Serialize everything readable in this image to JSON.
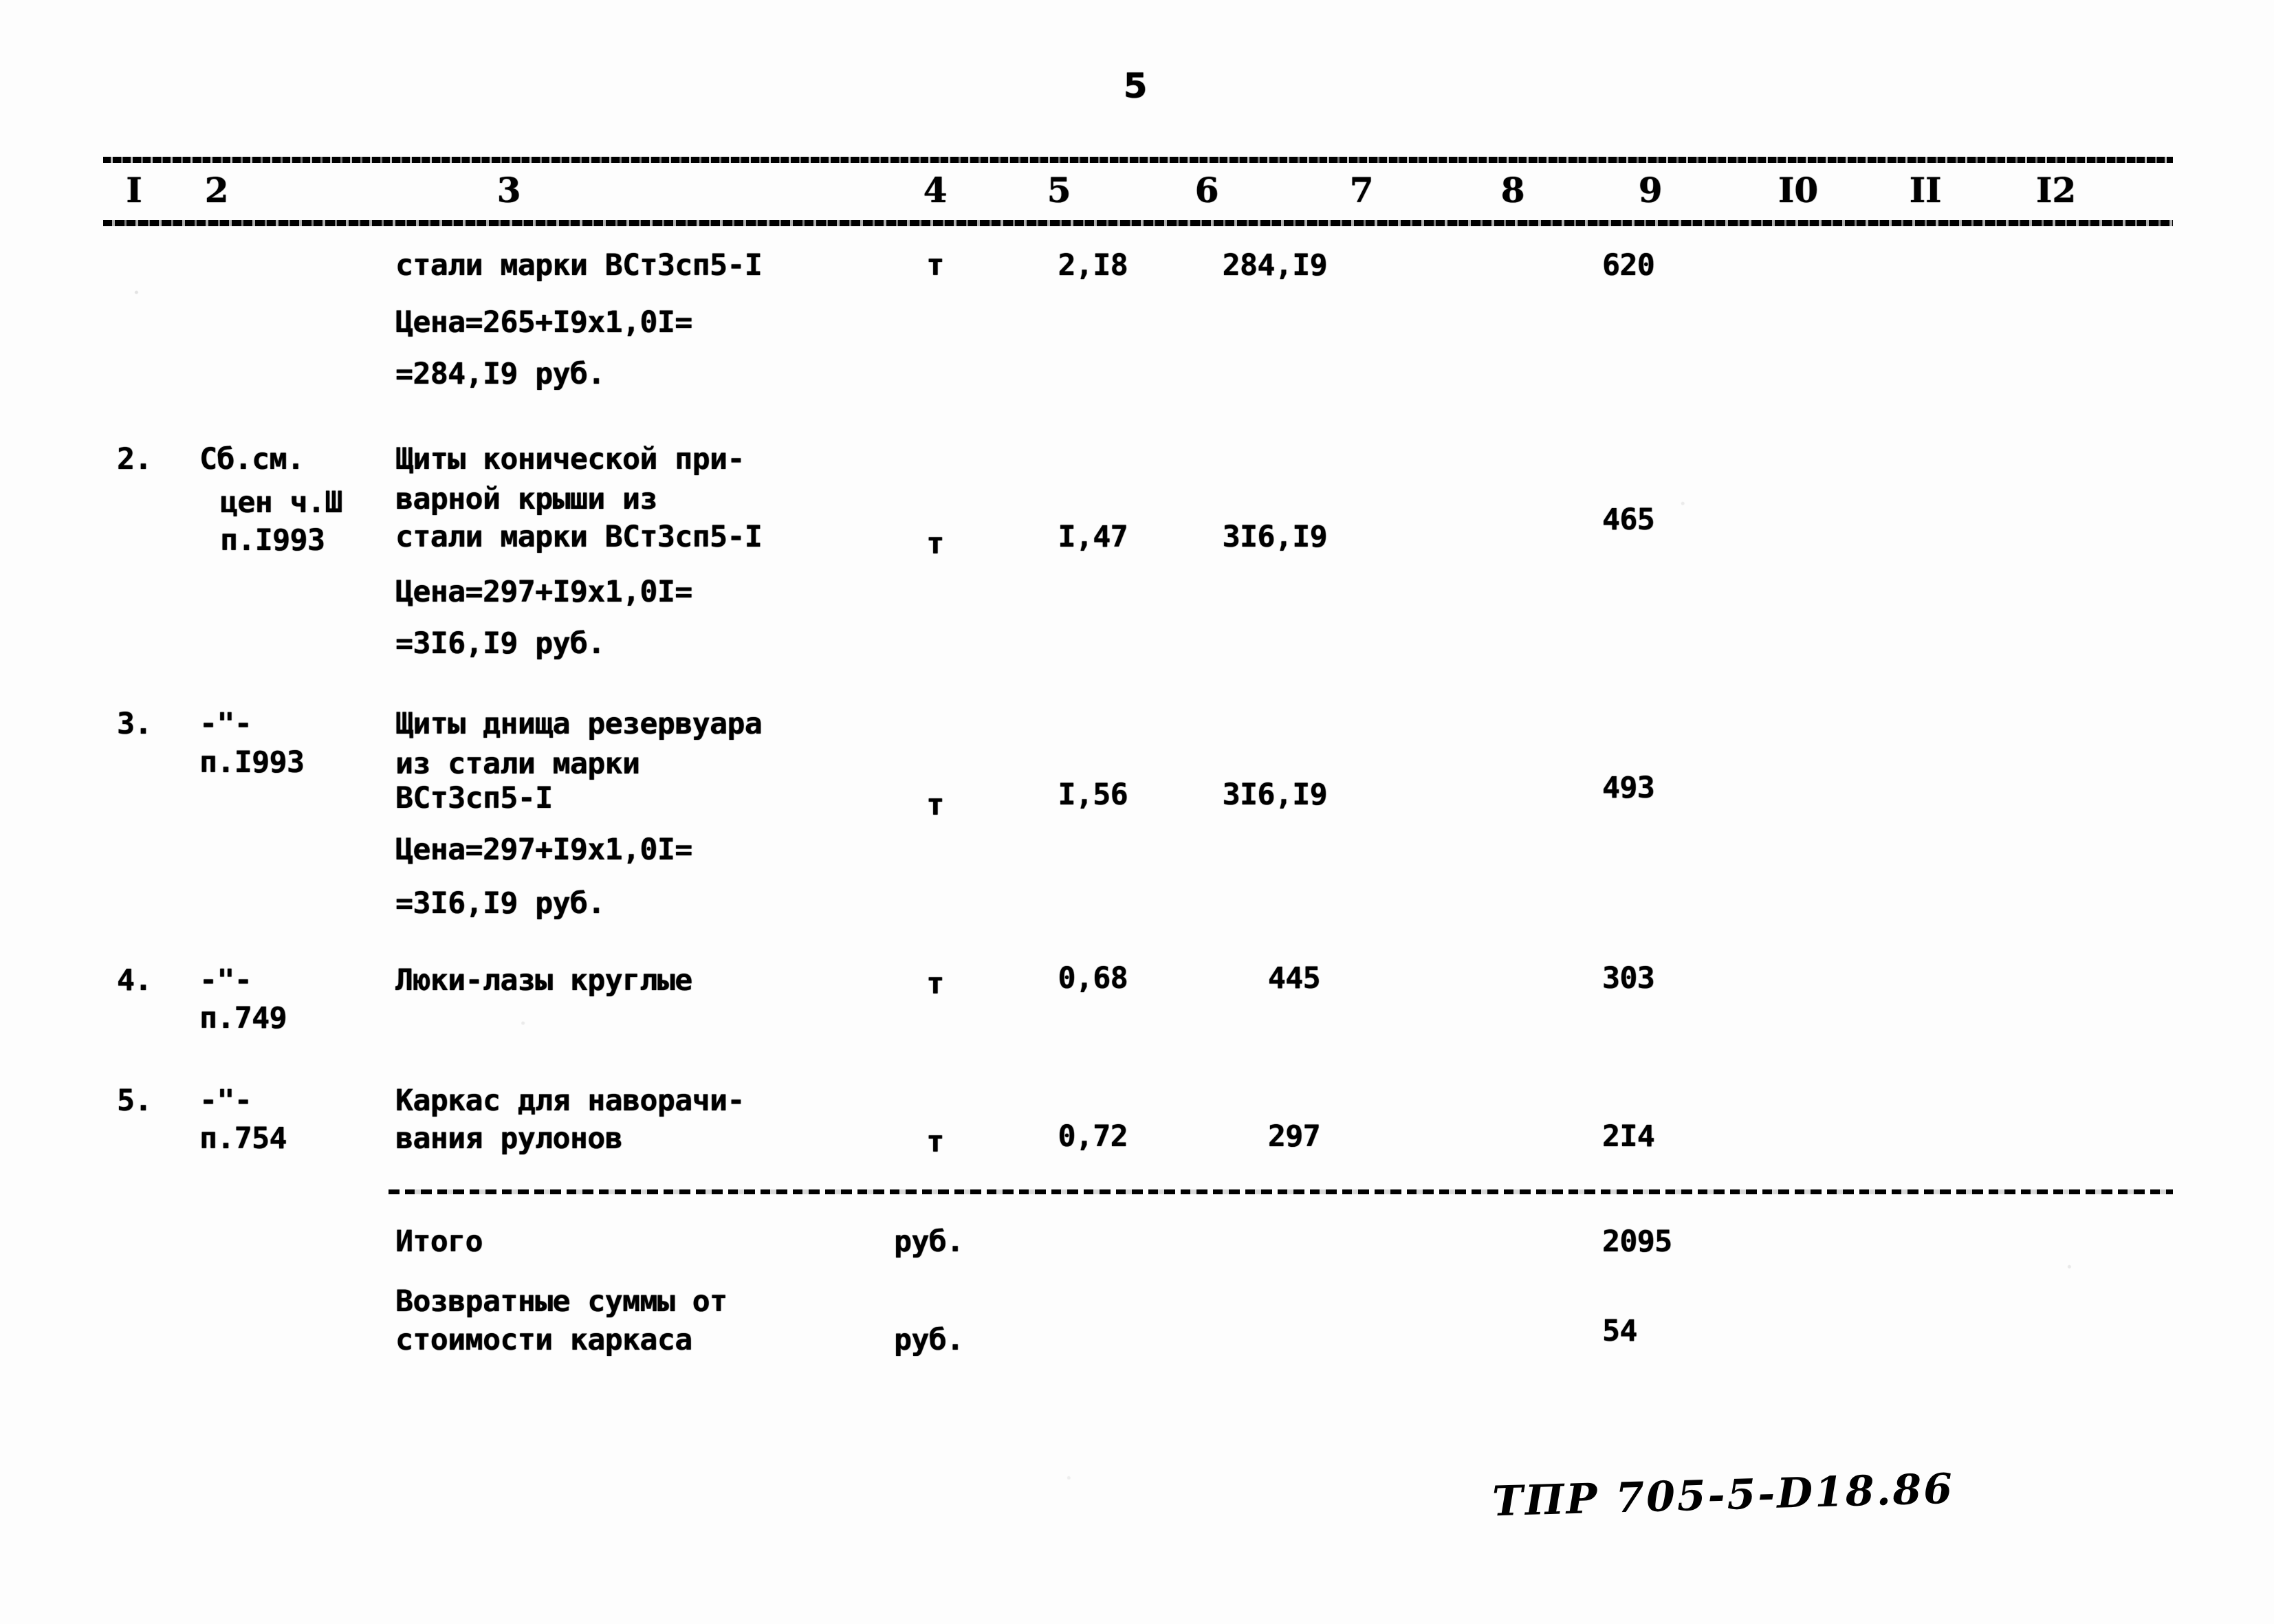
{
  "document": {
    "page_number": "5",
    "footer_code": "ТПР 705-5-D18.86"
  },
  "table": {
    "column_headers": [
      "I",
      "2",
      "3",
      "4",
      "5",
      "6",
      "7",
      "8",
      "9",
      "I0",
      "II",
      "I2"
    ],
    "rows": [
      {
        "no": "",
        "justification": "",
        "description_lines": [
          "стали марки ВСт3сп5-I",
          "Цена=265+I9x1,0I=",
          "=284,I9 руб."
        ],
        "unit": "т",
        "quantity": "2,I8",
        "unit_price": "284,I9",
        "col7": "",
        "col8": "",
        "total": "620",
        "col10": "",
        "col11": "",
        "col12": ""
      },
      {
        "no": "2.",
        "justification": "Сб.см.\nцен ч.Ш\nп.I993",
        "description_lines": [
          "Щиты конической при-",
          "варной крыши из",
          "стали марки ВСт3сп5-I",
          "Цена=297+I9x1,0I=",
          "=3I6,I9 руб."
        ],
        "unit": "т",
        "quantity": "I,47",
        "unit_price": "3I6,I9",
        "col7": "",
        "col8": "",
        "total": "465",
        "col10": "",
        "col11": "",
        "col12": ""
      },
      {
        "no": "3.",
        "justification": "-\"-\nп.I993",
        "description_lines": [
          "Щиты днища резервуара",
          "из стали марки",
          "ВСт3сп5-I",
          "Цена=297+I9x1,0I=",
          "=3I6,I9 руб."
        ],
        "unit": "т",
        "quantity": "I,56",
        "unit_price": "3I6,I9",
        "col7": "",
        "col8": "",
        "total": "493",
        "col10": "",
        "col11": "",
        "col12": ""
      },
      {
        "no": "4.",
        "justification": "-\"-\nп.749",
        "description_lines": [
          "Люки-лазы круглые"
        ],
        "unit": "т",
        "quantity": "0,68",
        "unit_price": "445",
        "col7": "",
        "col8": "",
        "total": "303",
        "col10": "",
        "col11": "",
        "col12": ""
      },
      {
        "no": "5.",
        "justification": "-\"-\nп.754",
        "description_lines": [
          "Каркас для наворачи-",
          "вания рулонов"
        ],
        "unit": "т",
        "quantity": "0,72",
        "unit_price": "297",
        "col7": "",
        "col8": "",
        "total": "2I4",
        "col10": "",
        "col11": "",
        "col12": ""
      }
    ],
    "summary_rows": [
      {
        "label_lines": [
          "Итого"
        ],
        "unit": "руб.",
        "total": "2095"
      },
      {
        "label_lines": [
          "Возвратные суммы от",
          "стоимости каркаса"
        ],
        "unit": "руб.",
        "total": "54"
      }
    ]
  },
  "cells": {
    "h1": "I",
    "h2": "2",
    "h3": "3",
    "h4": "4",
    "h5": "5",
    "h6": "6",
    "h7": "7",
    "h8": "8",
    "h9": "9",
    "h10": "I0",
    "h11": "II",
    "h12": "I2",
    "r1_d1": "стали марки ВСт3сп5-I",
    "r1_d2": "Цена=265+I9x1,0I=",
    "r1_d3": "=284,I9 руб.",
    "r1_unit": "т",
    "r1_qty": "2,I8",
    "r1_price": "284,I9",
    "r1_total": "620",
    "r2_no": "2.",
    "r2_j1": "Сб.см.",
    "r2_j2": "цен ч.Ш",
    "r2_j3": "п.I993",
    "r2_d1": "Щиты конической при-",
    "r2_d2": "варной крыши из",
    "r2_d3": "стали марки ВСт3сп5-I",
    "r2_d4": "Цена=297+I9x1,0I=",
    "r2_d5": "=3I6,I9 руб.",
    "r2_unit": "т",
    "r2_qty": "I,47",
    "r2_price": "3I6,I9",
    "r2_total": "465",
    "r3_no": "3.",
    "r3_j1": "-\"-",
    "r3_j2": "п.I993",
    "r3_d1": "Щиты днища резервуара",
    "r3_d2": "из стали марки",
    "r3_d3": "ВСт3сп5-I",
    "r3_d4": "Цена=297+I9x1,0I=",
    "r3_d5": "=3I6,I9 руб.",
    "r3_unit": "т",
    "r3_qty": "I,56",
    "r3_price": "3I6,I9",
    "r3_total": "493",
    "r4_no": "4.",
    "r4_j1": "-\"-",
    "r4_j2": "п.749",
    "r4_d1": "Люки-лазы круглые",
    "r4_unit": "т",
    "r4_qty": "0,68",
    "r4_price": "445",
    "r4_total": "303",
    "r5_no": "5.",
    "r5_j1": "-\"-",
    "r5_j2": "п.754",
    "r5_d1": "Каркас для наворачи-",
    "r5_d2": "вания рулонов",
    "r5_unit": "т",
    "r5_qty": "0,72",
    "r5_price": "297",
    "r5_total": "2I4",
    "s1_l1": "Итого",
    "s1_unit": "руб.",
    "s1_total": "2095",
    "s2_l1": "Возвратные суммы от",
    "s2_l2": "стоимости каркаса",
    "s2_unit": "руб.",
    "s2_total": "54"
  }
}
